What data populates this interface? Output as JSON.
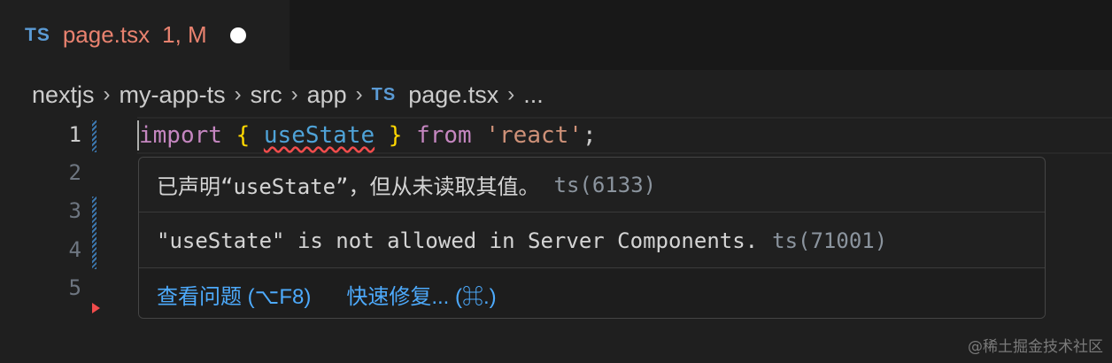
{
  "tab": {
    "badge": "TS",
    "filename": "page.tsx",
    "status": "1, M"
  },
  "breadcrumb": {
    "items": [
      "nextjs",
      "my-app-ts",
      "src",
      "app"
    ],
    "file_badge": "TS",
    "file": "page.tsx",
    "more": "...",
    "separator": "›"
  },
  "editor": {
    "line_numbers": [
      "1",
      "2",
      "3",
      "4",
      "5"
    ],
    "code": {
      "kw_import": "import",
      "open_brace": "{",
      "identifier": "useState",
      "close_brace": "}",
      "kw_from": "from",
      "string": "'react'",
      "semicolon": ";"
    }
  },
  "hover": {
    "message1": "已声明“useState”，但从未读取其值。",
    "code1": "ts(6133)",
    "message2": "\"useState\" is not allowed in Server Components.",
    "code2": "ts(71001)",
    "view_problem": "查看问题 (⌥F8)",
    "quick_fix": "快速修复... (⌘.)"
  },
  "watermark": "@稀土掘金技术社区",
  "colors": {
    "error": "#f14c4c",
    "link": "#4daafc",
    "modified_tab": "#e8826f",
    "ts_badge": "#5b9bd5"
  }
}
